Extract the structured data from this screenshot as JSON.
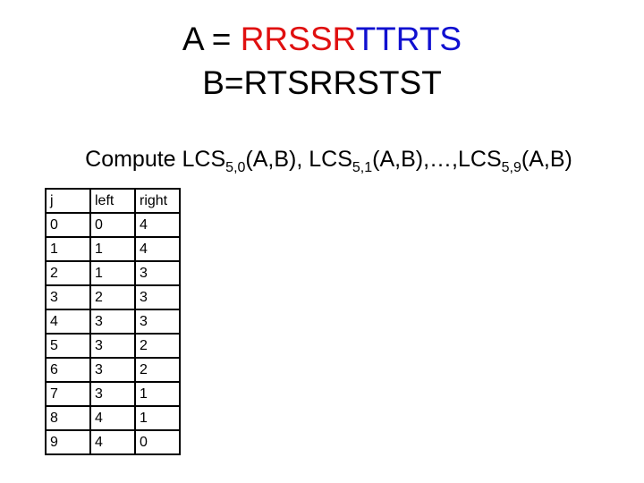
{
  "title": {
    "a_prefix": "A = ",
    "a_red": "RRSSR",
    "a_blue": "TTRTS",
    "b": "B=RTSRRSTST",
    "colors": {
      "red": "#e01010",
      "blue": "#1010d0"
    }
  },
  "compute": {
    "p1": "Compute LCS",
    "s1": "5,0",
    "p2": "(A,B), LCS",
    "s2": "5,1",
    "p3": "(A,B),…,LCS",
    "s3": "5,9",
    "p4": "(A,B)"
  },
  "table": {
    "headers": [
      "j",
      "left",
      "right"
    ],
    "rows": [
      [
        "0",
        "0",
        "4"
      ],
      [
        "1",
        "1",
        "4"
      ],
      [
        "2",
        "1",
        "3"
      ],
      [
        "3",
        "2",
        "3"
      ],
      [
        "4",
        "3",
        "3"
      ],
      [
        "5",
        "3",
        "2"
      ],
      [
        "6",
        "3",
        "2"
      ],
      [
        "7",
        "3",
        "1"
      ],
      [
        "8",
        "4",
        "1"
      ],
      [
        "9",
        "4",
        "0"
      ]
    ]
  }
}
